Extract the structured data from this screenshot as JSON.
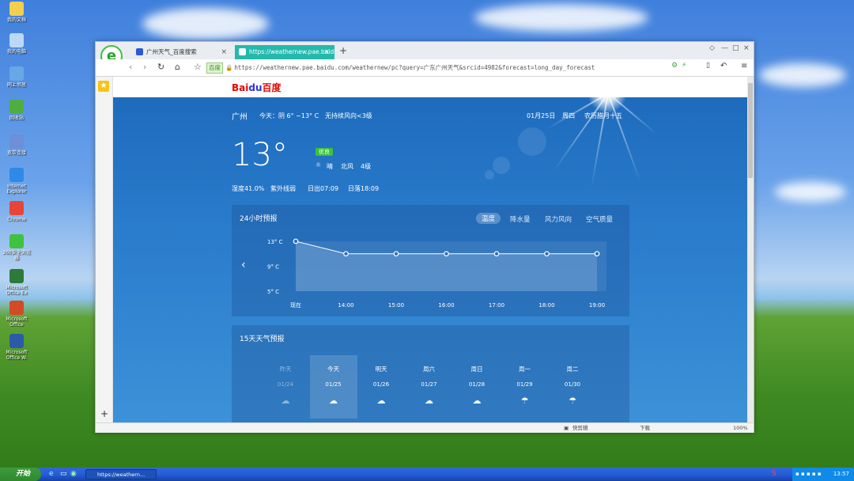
{
  "desktop": {
    "icons": [
      {
        "label": "我的文档",
        "color": "#f2cf4d"
      },
      {
        "label": "我的电脑",
        "color": "#bcd8f5"
      },
      {
        "label": "网上邻居",
        "color": "#6aa7e6"
      },
      {
        "label": "回收站",
        "color": "#4fae3f"
      },
      {
        "label": "宽带连接",
        "color": "#6c8fd8"
      },
      {
        "label": "Internet Explorer",
        "color": "#2e8ae6"
      },
      {
        "label": "Chrome",
        "color": "#e6453a"
      },
      {
        "label": "360安全浏览器",
        "color": "#3fc23f"
      },
      {
        "label": "Microsoft Office Ex",
        "color": "#2c7b3a"
      },
      {
        "label": "Microsoft Office",
        "color": "#d24a26"
      },
      {
        "label": "Microsoft Office W.",
        "color": "#2c5aa8"
      }
    ]
  },
  "browser": {
    "tabs": [
      {
        "label": "广州天气_百度搜索",
        "close": "×"
      },
      {
        "label": "https://weathernew.pae.baidu.c",
        "close": "×"
      }
    ],
    "new_tab": "+",
    "window_buttons": {
      "pin": "◇",
      "minimize": "—",
      "maximize": "□",
      "close": "×"
    },
    "address": {
      "badge": "百度",
      "url": "https://weathernew.pae.baidu.com/weathernew/pc?query=广东广州天气&srcid=4982&forecast=long_day_forecast"
    },
    "side_plus": "+",
    "status": {
      "items": [
        "快剪辑",
        "下载",
        "100%"
      ]
    }
  },
  "page": {
    "logo": {
      "a": "Bai",
      "b": "du",
      "c": "百度"
    },
    "weather": {
      "city": "广州",
      "today_summary": "今天：阴 6° ~13° C",
      "wind_summary": "无持续风向<3级",
      "date": "01月25日",
      "weekday": "周四",
      "lunar": "农历腊月十五",
      "temperature": "13°",
      "aqi": "优良",
      "condition": "晴",
      "wind_dir": "北风",
      "wind_level": "4级",
      "humidity": "湿度41.0%",
      "uv": "紫外线弱",
      "sunrise": "日出07:09",
      "sunset": "日落18:09"
    },
    "hourly": {
      "title": "24小时预报",
      "tabs": [
        "温度",
        "降水量",
        "风力风向",
        "空气质量"
      ]
    },
    "daily": {
      "title": "15天天气预报",
      "days": [
        {
          "name": "昨天",
          "date": "01/24",
          "icon": "☁"
        },
        {
          "name": "今天",
          "date": "01/25",
          "icon": "☁"
        },
        {
          "name": "明天",
          "date": "01/26",
          "icon": "☁"
        },
        {
          "name": "周六",
          "date": "01/27",
          "icon": "☁"
        },
        {
          "name": "周日",
          "date": "01/28",
          "icon": "☁"
        },
        {
          "name": "周一",
          "date": "01/29",
          "icon": "☂"
        },
        {
          "name": "周二",
          "date": "01/30",
          "icon": "☂"
        }
      ]
    }
  },
  "chart_data": {
    "type": "area",
    "title": "",
    "x": [
      "现在",
      "14:00",
      "15:00",
      "16:00",
      "17:00",
      "18:00",
      "19:00"
    ],
    "series": [
      {
        "values": [
          13,
          11,
          11,
          11,
          11,
          11,
          11
        ]
      }
    ],
    "yticks": [
      "13° C",
      "9° C",
      "5° C"
    ],
    "ylim": [
      5,
      13
    ]
  },
  "taskbar": {
    "start": "开始",
    "task": "https://weathern...",
    "clock": "13:57"
  }
}
